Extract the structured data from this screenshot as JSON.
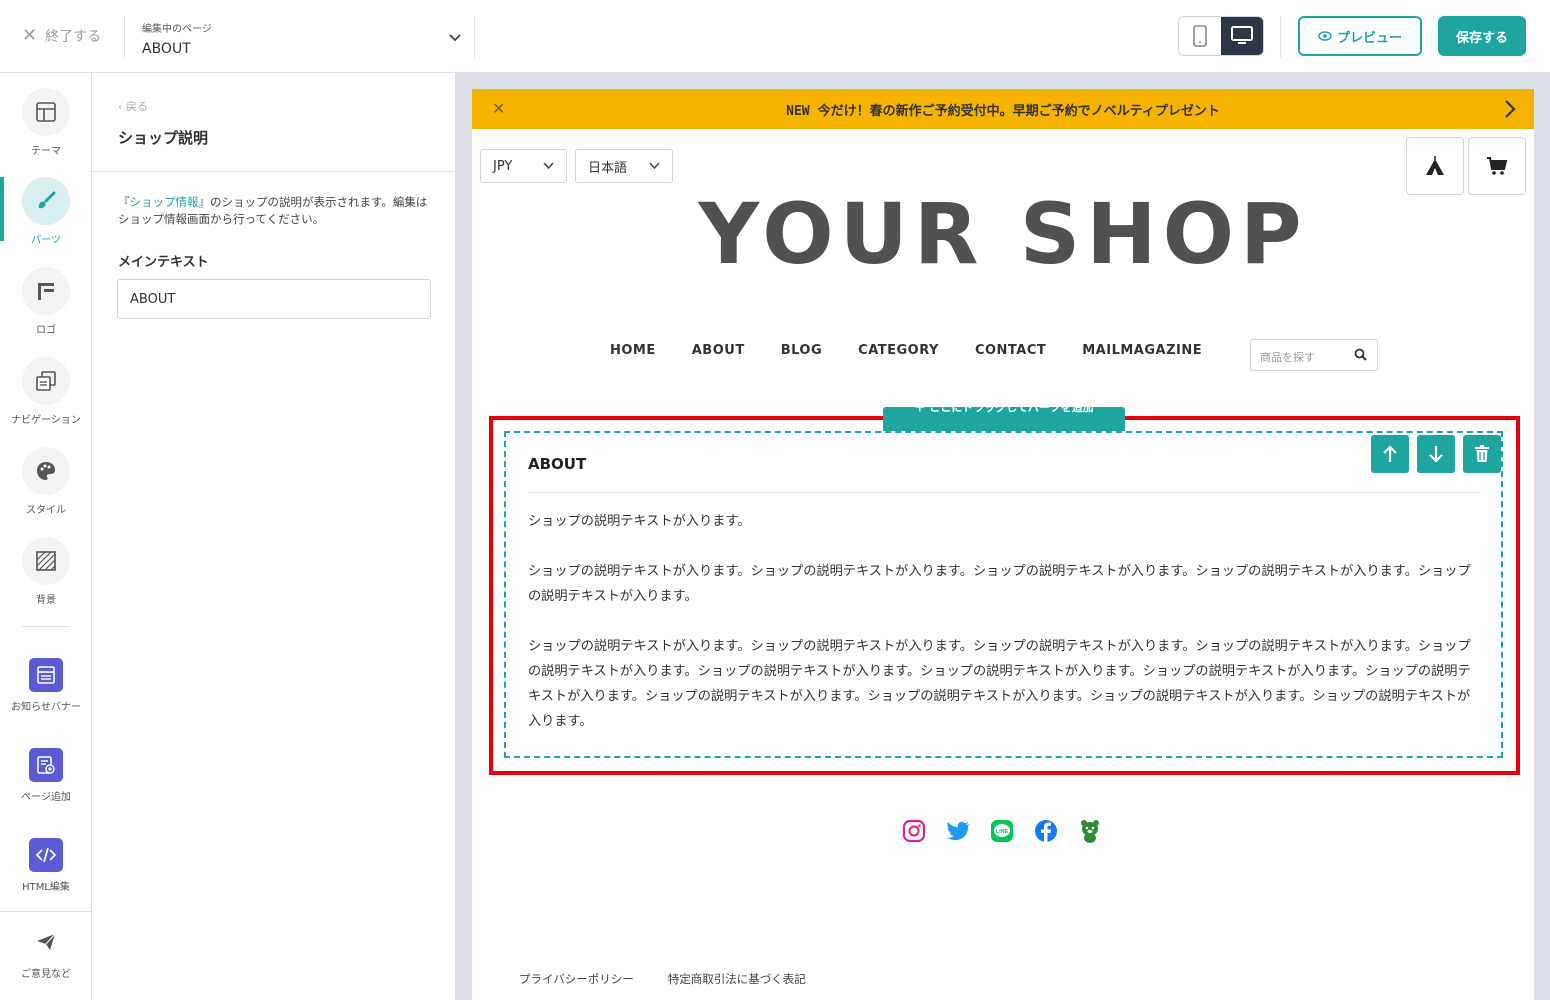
{
  "topbar": {
    "exit_label": "終了する",
    "page_caption": "編集中のページ",
    "page_value": "ABOUT",
    "preview_label": "プレビュー",
    "save_label": "保存する"
  },
  "rail": {
    "items": [
      {
        "label": "テーマ",
        "icon": "layout-icon"
      },
      {
        "label": "パーツ",
        "icon": "brush-icon"
      },
      {
        "label": "ロゴ",
        "icon": "flag-icon"
      },
      {
        "label": "ナビゲーション",
        "icon": "navigation-icon"
      },
      {
        "label": "スタイル",
        "icon": "palette-icon"
      },
      {
        "label": "背景",
        "icon": "background-icon"
      },
      {
        "label": "お知らせバナー",
        "icon": "banner-icon"
      },
      {
        "label": "ページ追加",
        "icon": "add-page-icon"
      },
      {
        "label": "HTML編集",
        "icon": "code-icon"
      },
      {
        "label": "ご意見など",
        "icon": "paper-plane-icon"
      }
    ]
  },
  "panel": {
    "back_label": "戻る",
    "title": "ショップ説明",
    "desc_prefix": "『",
    "desc_link": "ショップ情報",
    "desc_suffix": "』のショップの説明が表示されます。編集はショップ情報画面から行ってください。",
    "field_label": "メインテキスト",
    "field_value": "ABOUT"
  },
  "preview": {
    "notice_new": "NEW",
    "notice_text": "今だけ！春の新作ご予約受付中。早期ご予約でノベルティプレゼント",
    "currency": "JPY",
    "language": "日本語",
    "logo": "YOUR SHOP",
    "nav": [
      "HOME",
      "ABOUT",
      "BLOG",
      "CATEGORY",
      "CONTACT",
      "MAILMAGAZINE"
    ],
    "search_placeholder": "商品を探す",
    "add_tab_label": "＋ ここにドラッグしてパーツを追加",
    "block_title": "ABOUT",
    "paragraphs": [
      "ショップの説明テキストが入ります。",
      "ショップの説明テキストが入ります。ショップの説明テキストが入ります。ショップの説明テキストが入ります。ショップの説明テキストが入ります。ショップの説明テキストが入ります。",
      "ショップの説明テキストが入ります。ショップの説明テキストが入ります。ショップの説明テキストが入ります。ショップの説明テキストが入ります。ショップの説明テキストが入ります。ショップの説明テキストが入ります。ショップの説明テキストが入ります。ショップの説明テキストが入ります。ショップの説明テキストが入ります。ショップの説明テキストが入ります。ショップの説明テキストが入ります。ショップの説明テキストが入ります。ショップの説明テキストが入ります。"
    ],
    "social_icons": [
      "instagram-icon",
      "twitter-icon",
      "line-icon",
      "facebook-icon",
      "base-bear-icon"
    ],
    "footer_links": [
      "プライバシーポリシー",
      "特定商取引法に基づく表記"
    ]
  },
  "colors": {
    "accent": "#1ea5a0",
    "notice": "#f5b300",
    "highlight": "#e8000b",
    "rail_square": "#5b5bd6"
  }
}
